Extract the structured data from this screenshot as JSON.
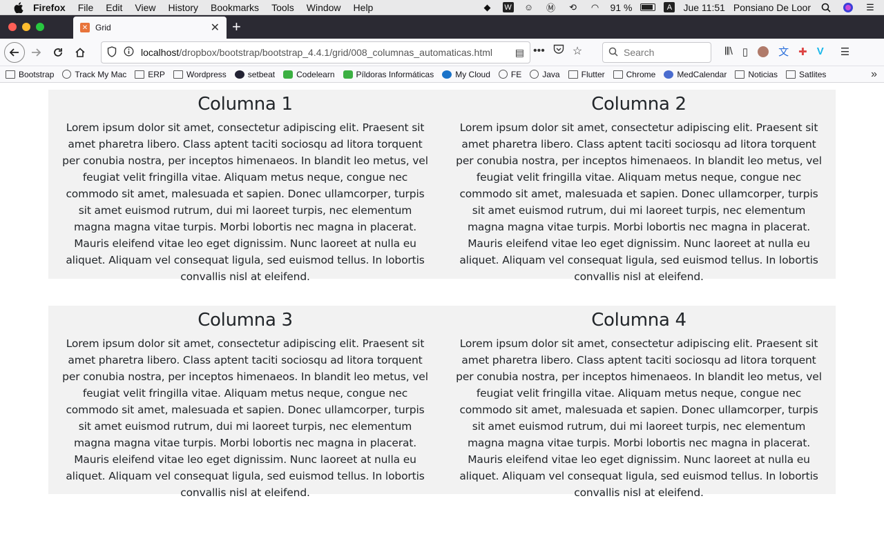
{
  "menubar": {
    "app_name": "Firefox",
    "menus": [
      "File",
      "Edit",
      "View",
      "History",
      "Bookmarks",
      "Tools",
      "Window",
      "Help"
    ],
    "battery": "91 %",
    "input_source": "A",
    "clock": "Jue 11:51",
    "user": "Ponsiano De Loor"
  },
  "tab": {
    "title": "Grid",
    "favicon_color": "#e8743b"
  },
  "navbar": {
    "url_host": "localhost",
    "url_path": "/dropbox/bootstrap/bootstrap_4.4.1/grid/008_columnas_automaticas.html",
    "search_placeholder": "Search"
  },
  "bookmarks": [
    {
      "label": "Bootstrap",
      "icon": "folder"
    },
    {
      "label": "Track My Mac",
      "icon": "globe"
    },
    {
      "label": "ERP",
      "icon": "folder"
    },
    {
      "label": "Wordpress",
      "icon": "folder"
    },
    {
      "label": "setbeat",
      "icon": "dark"
    },
    {
      "label": "Codelearn",
      "icon": "green"
    },
    {
      "label": "Píldoras Informáticas",
      "icon": "green"
    },
    {
      "label": "My Cloud",
      "icon": "blue"
    },
    {
      "label": "FE",
      "icon": "globe"
    },
    {
      "label": "Java",
      "icon": "globe"
    },
    {
      "label": "Flutter",
      "icon": "folder"
    },
    {
      "label": "Chrome",
      "icon": "folder"
    },
    {
      "label": "MedCalendar",
      "icon": "med"
    },
    {
      "label": "Noticias",
      "icon": "folder"
    },
    {
      "label": "Satlites",
      "icon": "folder"
    }
  ],
  "columns": [
    {
      "title": "Columna 1",
      "text": "Lorem ipsum dolor sit amet, consectetur adipiscing elit. Praesent sit amet pharetra libero. Class aptent taciti sociosqu ad litora torquent per conubia nostra, per inceptos himenaeos. In blandit leo metus, vel feugiat velit fringilla vitae. Aliquam metus neque, congue nec commodo sit amet, malesuada et sapien. Donec ullamcorper, turpis sit amet euismod rutrum, dui mi laoreet turpis, nec elementum magna magna vitae turpis. Morbi lobortis nec magna in placerat. Mauris eleifend vitae leo eget dignissim. Nunc laoreet at nulla eu aliquet. Aliquam vel consequat ligula, sed euismod tellus. In lobortis convallis nisl at eleifend."
    },
    {
      "title": "Columna 2",
      "text": "Lorem ipsum dolor sit amet, consectetur adipiscing elit. Praesent sit amet pharetra libero. Class aptent taciti sociosqu ad litora torquent per conubia nostra, per inceptos himenaeos. In blandit leo metus, vel feugiat velit fringilla vitae. Aliquam metus neque, congue nec commodo sit amet, malesuada et sapien. Donec ullamcorper, turpis sit amet euismod rutrum, dui mi laoreet turpis, nec elementum magna magna vitae turpis. Morbi lobortis nec magna in placerat. Mauris eleifend vitae leo eget dignissim. Nunc laoreet at nulla eu aliquet. Aliquam vel consequat ligula, sed euismod tellus. In lobortis convallis nisl at eleifend."
    },
    {
      "title": "Columna 3",
      "text": "Lorem ipsum dolor sit amet, consectetur adipiscing elit. Praesent sit amet pharetra libero. Class aptent taciti sociosqu ad litora torquent per conubia nostra, per inceptos himenaeos. In blandit leo metus, vel feugiat velit fringilla vitae. Aliquam metus neque, congue nec commodo sit amet, malesuada et sapien. Donec ullamcorper, turpis sit amet euismod rutrum, dui mi laoreet turpis, nec elementum magna magna vitae turpis. Morbi lobortis nec magna in placerat. Mauris eleifend vitae leo eget dignissim. Nunc laoreet at nulla eu aliquet. Aliquam vel consequat ligula, sed euismod tellus. In lobortis convallis nisl at eleifend."
    },
    {
      "title": "Columna 4",
      "text": "Lorem ipsum dolor sit amet, consectetur adipiscing elit. Praesent sit amet pharetra libero. Class aptent taciti sociosqu ad litora torquent per conubia nostra, per inceptos himenaeos. In blandit leo metus, vel feugiat velit fringilla vitae. Aliquam metus neque, congue nec commodo sit amet, malesuada et sapien. Donec ullamcorper, turpis sit amet euismod rutrum, dui mi laoreet turpis, nec elementum magna magna vitae turpis. Morbi lobortis nec magna in placerat. Mauris eleifend vitae leo eget dignissim. Nunc laoreet at nulla eu aliquet. Aliquam vel consequat ligula, sed euismod tellus. In lobortis convallis nisl at eleifend."
    }
  ]
}
